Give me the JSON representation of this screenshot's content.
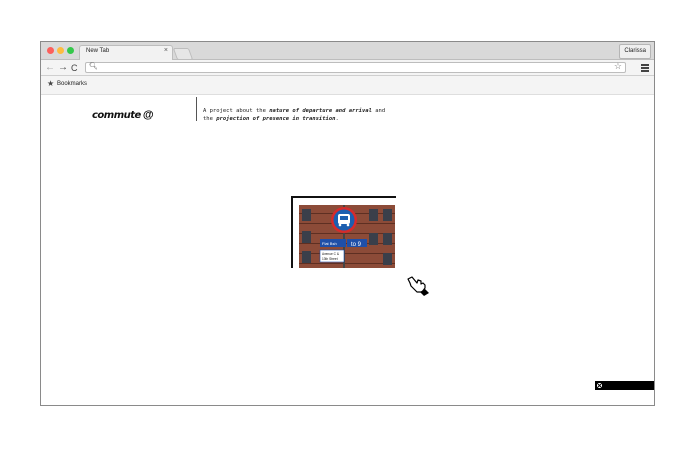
{
  "browser": {
    "tab_title": "New Tab",
    "tab_close": "×",
    "profile_name": "Clarissa",
    "nav": {
      "back": "←",
      "forward": "→",
      "reload": "C"
    },
    "omnibox": {
      "search_glyph": "🔍︎",
      "value": "",
      "star": "☆"
    },
    "bookmarks": {
      "star": "★",
      "label": "Bookmarks"
    }
  },
  "page": {
    "logo_text": "commute",
    "logo_at": "@",
    "tagline": {
      "p1": "A project about the ",
      "e1": "nature of departure and arrival",
      "p2": " and",
      "p3": "the ",
      "e2": "projection of presence in transition",
      "p4": "."
    },
    "sign": {
      "street_a": "Flat Bsh",
      "street_b": "Ave",
      "street_c": "Avenue C &",
      "street_d": "13th Street",
      "number": "to 9"
    }
  }
}
